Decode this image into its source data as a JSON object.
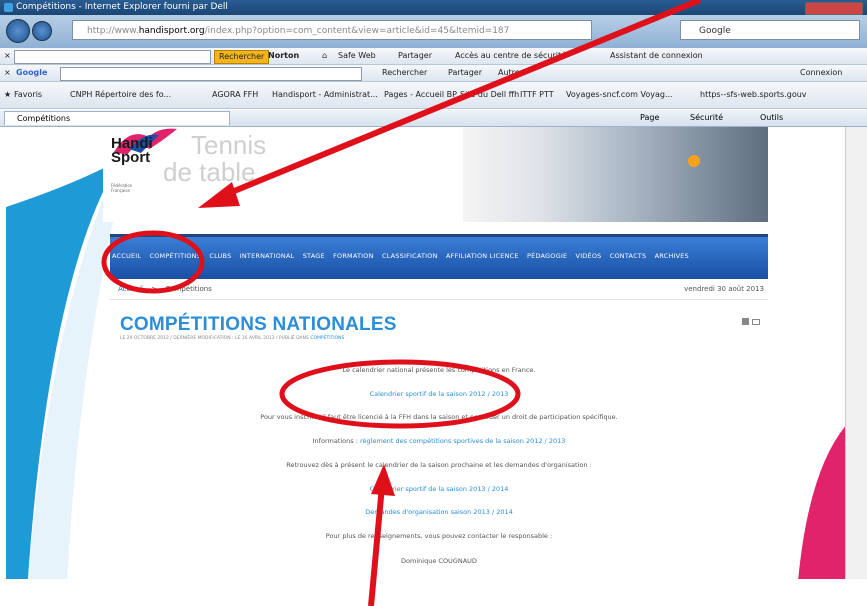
{
  "browser": {
    "window_title": "Compétitions - Internet Explorer fourni par Dell",
    "url_prefix": "http://www.",
    "url_domain": "handisport.org",
    "url_path": "/index.php?option=com_content&view=article&id=45&Itemid=187",
    "search_engine": "Google",
    "google_label": "Google",
    "toolbar1": {
      "search_button": "Rechercher",
      "norton": "Norton",
      "safeweb": "Safe Web",
      "share": "Partager",
      "signin_center": "Accès au centre de sécurité",
      "assistant": "Assistant de connexion"
    },
    "toolbar2": {
      "search": "Rechercher",
      "share": "Partager",
      "more": "Autres",
      "connexion": "Connexion"
    },
    "favorites": {
      "label": "Favoris",
      "items": [
        "CNPH Répertoire des fo...",
        "AGORA FFH",
        "Handisport - Administrat...",
        "Pages - Accueil BP",
        "Site du Dell ffh",
        "ITTF PTT",
        "Voyages-sncf.com Voyag...",
        "https--sfs-web.sports.gouv"
      ]
    },
    "tab": {
      "label": "Compétitions"
    },
    "commandbar": {
      "page": "Page",
      "security": "Sécurité",
      "tools": "Outils"
    }
  },
  "site": {
    "logo_line1": "Handi",
    "logo_line2": "Sport",
    "logo_sub": "Fédération Française",
    "banner_word1": "Tennis",
    "banner_word2": "de table",
    "nav": [
      "Accueil",
      "Compétitions",
      "Clubs",
      "International",
      "Stage",
      "Formation",
      "Classification",
      "Affiliation Licence",
      "Pédagogie",
      "Vidéos",
      "Contacts",
      "Archives"
    ],
    "breadcrumb_home": "Accueil",
    "breadcrumb_sep": ">",
    "breadcrumb_current": "Compétitions",
    "date": "vendredi 30 août 2013"
  },
  "article": {
    "title": "COMPÉTITIONS NATIONALES",
    "meta_prefix": "LE 29 OCTOBRE 2012 / DERNIÈRE MODIFICATION : LE 16 AVRIL 2013 / PUBLIÉ DANS",
    "meta_category": "COMPÉTITIONS",
    "p1": "Le calendrier national présente les compétitions en France.",
    "link1": "Calendrier sportif de la saison 2012 / 2013",
    "p2": "Pour vous inscrire, il faut être licencié à la FFH dans la saison et posséder un droit de participation spécifique.",
    "p3_label": "Informations :",
    "link2": "règlement des compétitions sportives de la saison 2012 / 2013",
    "p4": "Retrouvez dès à présent le calendrier de la saison prochaine et les demandes d'organisation :",
    "link3": "Calendrier sportif de la saison 2013 / 2014",
    "link4": "Demandes d'organisation saison 2013 / 2014",
    "p5": "Pour plus de renseignements, vous pouvez contacter le responsable :",
    "contact": "Dominique COUGNAUD"
  },
  "colors": {
    "nav_blue": "#1e5cb8",
    "link_blue": "#2a8fd8",
    "annotation_red": "#e0101b"
  }
}
